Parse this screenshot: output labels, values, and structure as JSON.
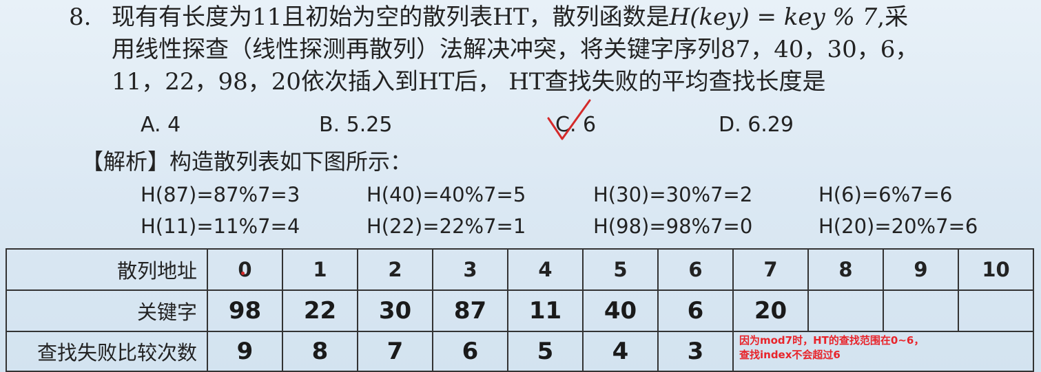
{
  "question": {
    "number": "8.",
    "line1_text": "现有有长度为11且初始为空的散列表HT，散列函数是",
    "line1_math": "H(key) = key % 7",
    "line1_tail": ",采",
    "line2": "用线性探查（线性探测再散列）法解决冲突，将关键字序列87，40，30，6，",
    "line3": "11，22，98，20依次插入到HT后， HT查找失败的平均查找长度是"
  },
  "options": [
    {
      "label": "A.",
      "value": "4"
    },
    {
      "label": "B.",
      "value": "5.25"
    },
    {
      "label": "C.",
      "value": "6"
    },
    {
      "label": "D.",
      "value": "6.29"
    }
  ],
  "correct_mark": {
    "icon": "check-mark-icon",
    "color": "#d42a2a"
  },
  "analysis": {
    "title": "【解析】构造散列表如下图所示："
  },
  "hash_calcs": [
    [
      "H(87)=87%7=3",
      "H(40)=40%7=5",
      "H(30)=30%7=2",
      "H(6)=6%7=6"
    ],
    [
      "H(11)=11%7=4",
      "H(22)=22%7=1",
      "H(98)=98%7=0",
      "H(20)=20%7=6"
    ]
  ],
  "table": {
    "row_headers": [
      "散列地址",
      "关键字",
      "查找失败比较次数"
    ],
    "addresses": [
      "0",
      "1",
      "2",
      "3",
      "4",
      "5",
      "6",
      "7",
      "8",
      "9",
      "10"
    ],
    "keys": [
      "98",
      "22",
      "30",
      "87",
      "11",
      "40",
      "6",
      "20",
      "",
      "",
      ""
    ],
    "compares": [
      "9",
      "8",
      "7",
      "6",
      "5",
      "4",
      "3"
    ]
  },
  "note": {
    "line1": "因为mod7时，HT的查找范围在0~6，",
    "line2": "查找index不会超过6",
    "color": "#e8242a"
  }
}
